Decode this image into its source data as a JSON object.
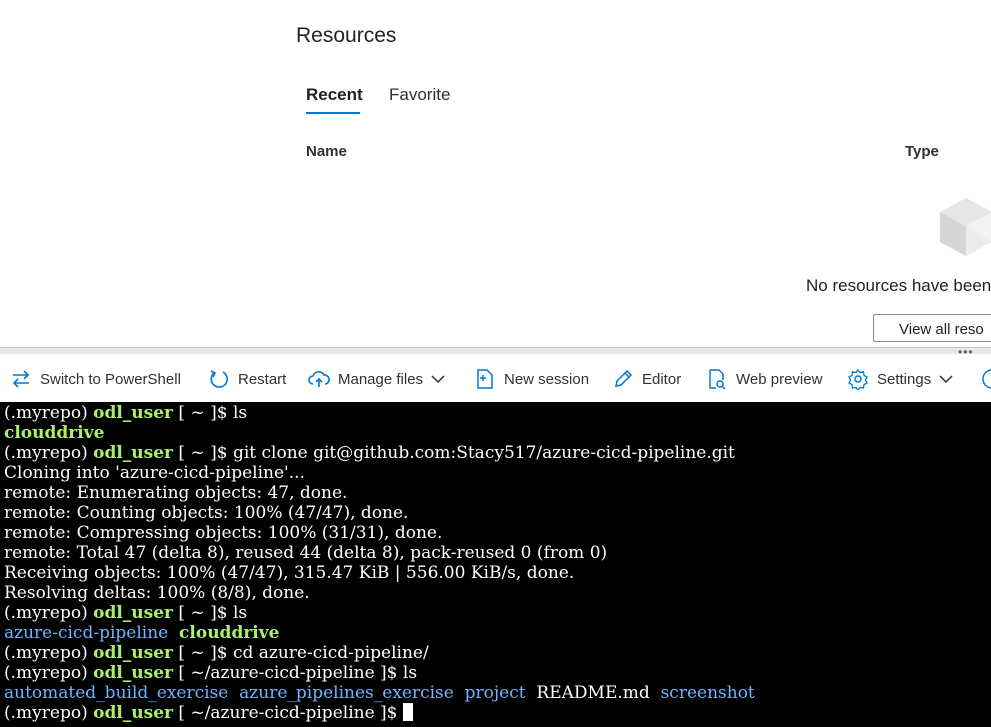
{
  "resources": {
    "title": "Resources",
    "tabs": [
      {
        "label": "Recent",
        "selected": true
      },
      {
        "label": "Favorite",
        "selected": false
      }
    ],
    "columns": {
      "name": "Name",
      "type": "Type"
    },
    "empty_message": "No resources have been",
    "view_all_label": "View all reso",
    "accent_color": "#0078d4"
  },
  "toolbar": {
    "items": [
      {
        "label": "Switch to PowerShell",
        "icon": "switch-arrows-icon"
      },
      {
        "label": "Restart",
        "icon": "restart-icon"
      },
      {
        "label": "Manage files",
        "icon": "cloud-upload-icon",
        "has_dropdown": true
      },
      {
        "label": "New session",
        "icon": "new-session-icon"
      },
      {
        "label": "Editor",
        "icon": "pencil-icon"
      },
      {
        "label": "Web preview",
        "icon": "web-preview-icon"
      },
      {
        "label": "Settings",
        "icon": "gear-icon",
        "has_dropdown": true
      }
    ]
  },
  "terminal": {
    "prompt_env": "(.myrepo) ",
    "prompt_user": "odl_user",
    "lines": {
      "l0_path": " [ ~ ]$ ",
      "l0_cmd": "ls",
      "l1_out": "clouddrive",
      "l2_path": " [ ~ ]$ ",
      "l2_cmd": "git clone git@github.com:Stacy517/azure-cicd-pipeline.git",
      "l3": "Cloning into 'azure-cicd-pipeline'...",
      "l4": "remote: Enumerating objects: 47, done.",
      "l5": "remote: Counting objects: 100% (47/47), done.",
      "l6": "remote: Compressing objects: 100% (31/31), done.",
      "l7": "remote: Total 47 (delta 8), reused 44 (delta 8), pack-reused 0 (from 0)",
      "l8": "Receiving objects: 100% (47/47), 315.47 KiB | 556.00 KiB/s, done.",
      "l9": "Resolving deltas: 100% (8/8), done.",
      "l10_path": " [ ~ ]$ ",
      "l10_cmd": "ls",
      "l11_a": "azure-cicd-pipeline",
      "l11_b": "clouddrive",
      "l12_path": " [ ~ ]$ ",
      "l12_cmd": "cd azure-cicd-pipeline/",
      "l13_path": " [ ~/azure-cicd-pipeline ]$ ",
      "l13_cmd": "ls",
      "l14_a": "automated_build_exercise",
      "l14_b": "azure_pipelines_exercise",
      "l14_c": "project",
      "l14_d": "README.md",
      "l14_e": "screenshot",
      "l15_path": " [ ~/azure-cicd-pipeline ]$ "
    },
    "colors": {
      "background": "#000000",
      "user": "#aaf06a",
      "directory": "#6fb4ff",
      "text": "#ffffff"
    }
  }
}
